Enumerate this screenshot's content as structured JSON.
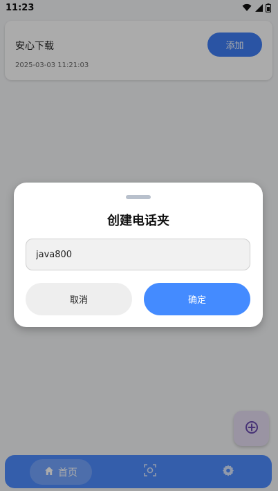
{
  "status_bar": {
    "time": "11:23",
    "icons": [
      "wifi-icon",
      "signal-icon",
      "battery-icon"
    ]
  },
  "card": {
    "title": "安心下载",
    "timestamp": "2025-03-03 11:21:03",
    "add_label": "添加"
  },
  "dialog": {
    "title": "创建电话夹",
    "input_value": "java800",
    "cancel_label": "取消",
    "confirm_label": "确定"
  },
  "fab": {
    "icon": "add-circle-icon"
  },
  "bottom_nav": {
    "items": [
      {
        "icon": "home-icon",
        "label": "首页",
        "selected": true
      },
      {
        "icon": "scan-icon",
        "label": "",
        "selected": false
      },
      {
        "icon": "settings-icon",
        "label": "",
        "selected": false
      }
    ]
  },
  "colors": {
    "accent": "#448bff",
    "nav_background": "#4e8cff",
    "fab_background": "#e6ddf3",
    "fab_icon": "#6a4bb0",
    "scrim": "rgba(0,0,0,0.33)"
  }
}
